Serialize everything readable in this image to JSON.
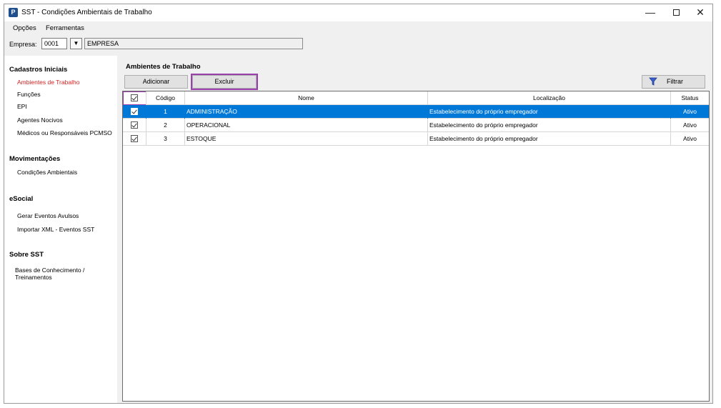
{
  "window": {
    "title": "SST - Condições Ambientais de Trabalho",
    "icon_letter": "P",
    "minimize": "—",
    "close": "✕"
  },
  "menu": {
    "opcoes": "Opções",
    "ferramentas": "Ferramentas"
  },
  "empresa": {
    "label": "Empresa:",
    "code": "0001",
    "dropdown": "▼",
    "name": "EMPRESA"
  },
  "sidebar": {
    "sections": [
      {
        "title": "Cadastros Iniciais",
        "items": [
          "Ambientes de Trabalho",
          "Funções",
          "EPI",
          "Agentes Nocivos",
          "Médicos ou Responsáveis PCMSO"
        ]
      },
      {
        "title": "Movimentações",
        "items": [
          "Condições Ambientais"
        ]
      },
      {
        "title": "eSocial",
        "items": [
          "Gerar Eventos Avulsos",
          "Importar XML - Eventos SST"
        ]
      },
      {
        "title": "Sobre SST",
        "items": [
          "Bases de Conhecimento /",
          "Treinamentos"
        ]
      }
    ],
    "active_item": "Ambientes de Trabalho"
  },
  "main": {
    "title": "Ambientes de Trabalho",
    "buttons": {
      "add": "Adicionar",
      "delete": "Excluir",
      "filter": "Filtrar"
    }
  },
  "grid": {
    "columns": [
      "Código",
      "Nome",
      "Localização",
      "Status"
    ],
    "rows": [
      {
        "checked": true,
        "codigo": "1",
        "nome": "ADMINISTRAÇÃO",
        "localizacao": "Estabelecimento do próprio empregador",
        "status": "Ativo",
        "selected": true
      },
      {
        "checked": true,
        "codigo": "2",
        "nome": "OPERACIONAL",
        "localizacao": "Estabelecimento do próprio empregador",
        "status": "Ativo",
        "selected": false
      },
      {
        "checked": true,
        "codigo": "3",
        "nome": "ESTOQUE",
        "localizacao": "Estabelecimento do próprio empregador",
        "status": "Ativo",
        "selected": false
      }
    ]
  },
  "colors": {
    "selection": "#0078d7",
    "highlight_outline": "#9b3fae",
    "active_link": "#d22222"
  }
}
